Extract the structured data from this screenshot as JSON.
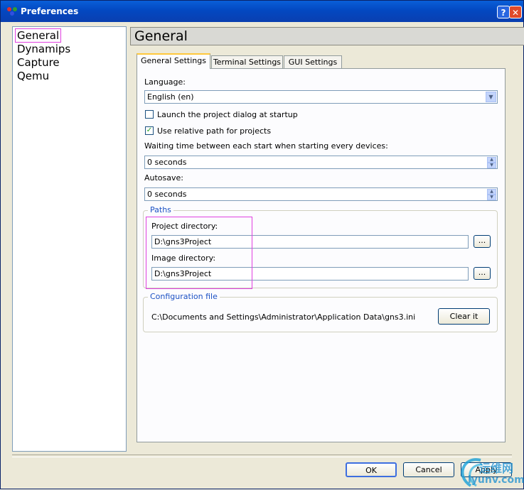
{
  "window": {
    "title": "Preferences",
    "help": "?",
    "close": "✕"
  },
  "nav": {
    "items": [
      "General",
      "Dynamips",
      "Capture",
      "Qemu"
    ]
  },
  "header": {
    "title": "General"
  },
  "tabs": [
    "General Settings",
    "Terminal Settings",
    "GUI Settings"
  ],
  "general": {
    "language_label": "Language:",
    "language_value": "English (en)",
    "launch_dialog_label": "Launch the project dialog at startup",
    "launch_dialog_checked": false,
    "relative_path_label": "Use relative path for projects",
    "relative_path_checked": true,
    "waiting_label": "Waiting time between each start when starting every devices:",
    "waiting_value": "0 seconds",
    "autosave_label": "Autosave:",
    "autosave_value": "0 seconds",
    "paths": {
      "title": "Paths",
      "project_label": "Project directory:",
      "project_value": "D:\\gns3Project",
      "image_label": "Image directory:",
      "image_value": "D:\\gns3Project",
      "browse": "..."
    },
    "config": {
      "title": "Configuration file",
      "path": "C:\\Documents and Settings\\Administrator\\Application Data\\gns3.ini",
      "clear": "Clear it"
    }
  },
  "buttons": {
    "ok": "OK",
    "cancel": "Cancel",
    "apply": "Apply"
  },
  "watermark": {
    "text": "运维网",
    "url": "iyunv.com"
  }
}
